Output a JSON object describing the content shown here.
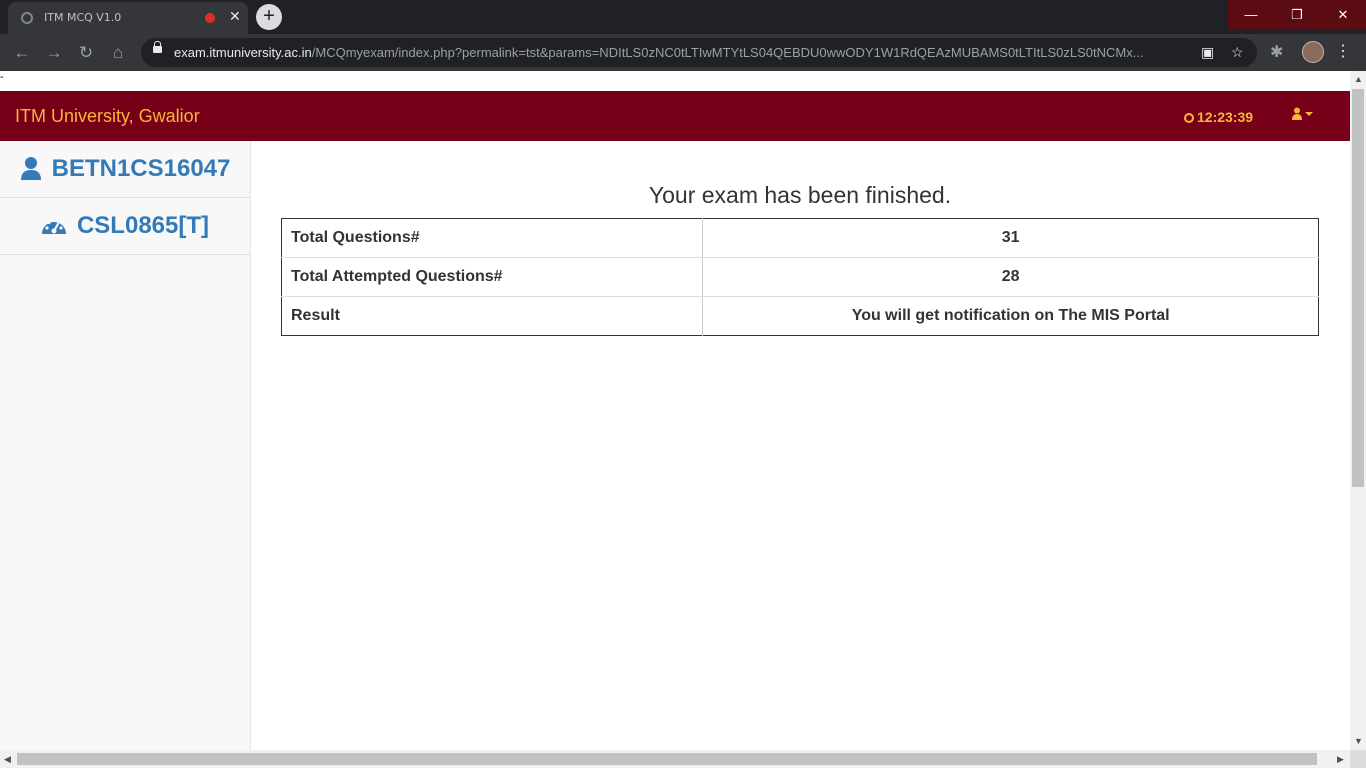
{
  "browser": {
    "tab_title": "ITM MCQ V1.0",
    "tab_close": "✕",
    "new_tab": "+",
    "url_host": "exam.itmuniversity.ac.in",
    "url_path": "/MCQmyexam/index.php?permalink=tst&params=NDItLS0zNC0tLTIwMTYtLS04QEBDU0wwODY1W1RdQEAzMUBAMS0tLTItLS0zLS0tNCMx...",
    "min": "—",
    "max": "❐",
    "close": "✕"
  },
  "page": {
    "top_mark": "-",
    "brand": "ITM University, Gwalior",
    "clock": "12:23:39"
  },
  "sidebar": {
    "user_id": "BETN1CS16047",
    "course": "CSL0865[T]"
  },
  "main": {
    "heading": "Your exam has been finished.",
    "rows": [
      {
        "label": "Total Questions#",
        "value": "31"
      },
      {
        "label": "Total Attempted Questions#",
        "value": "28"
      },
      {
        "label": "Result",
        "value": "You will get notification on The MIS Portal"
      }
    ]
  }
}
